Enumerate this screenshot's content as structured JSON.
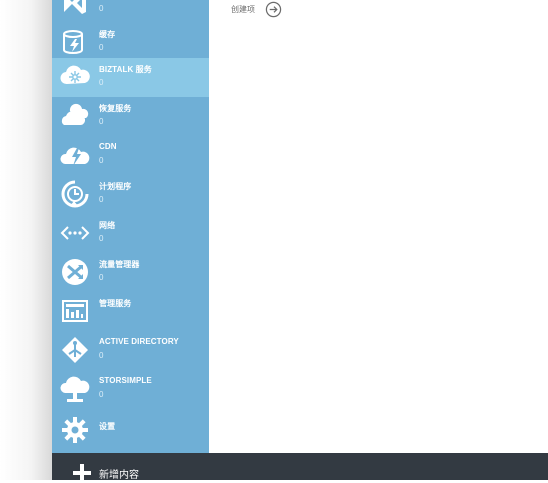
{
  "sidebar": {
    "items": [
      {
        "label": "",
        "count": "0",
        "icon": "visual-studio-icon"
      },
      {
        "label": "缓存",
        "count": "0",
        "icon": "cache-icon"
      },
      {
        "label": "BIZTALK 服务",
        "count": "0",
        "icon": "biztalk-icon"
      },
      {
        "label": "恢复服务",
        "count": "0",
        "icon": "recovery-icon"
      },
      {
        "label": "CDN",
        "count": "0",
        "icon": "cdn-icon"
      },
      {
        "label": "计划程序",
        "count": "0",
        "icon": "scheduler-icon"
      },
      {
        "label": "网络",
        "count": "0",
        "icon": "network-icon"
      },
      {
        "label": "流量管理器",
        "count": "0",
        "icon": "traffic-manager-icon"
      },
      {
        "label": "管理服务",
        "count": "",
        "icon": "management-services-icon"
      },
      {
        "label": "ACTIVE DIRECTORY",
        "count": "0",
        "icon": "active-directory-icon"
      },
      {
        "label": "STORSIMPLE",
        "count": "0",
        "icon": "storsimple-icon"
      },
      {
        "label": "设置",
        "count": "",
        "icon": "settings-icon"
      }
    ],
    "selected_index": 2
  },
  "main": {
    "create_label": "创建项"
  },
  "bottom_bar": {
    "new_label": "新增内容"
  },
  "colors": {
    "sidebar": "#6fafd6",
    "selected": "#8ac8e6",
    "bottom_bar": "#333a42"
  }
}
